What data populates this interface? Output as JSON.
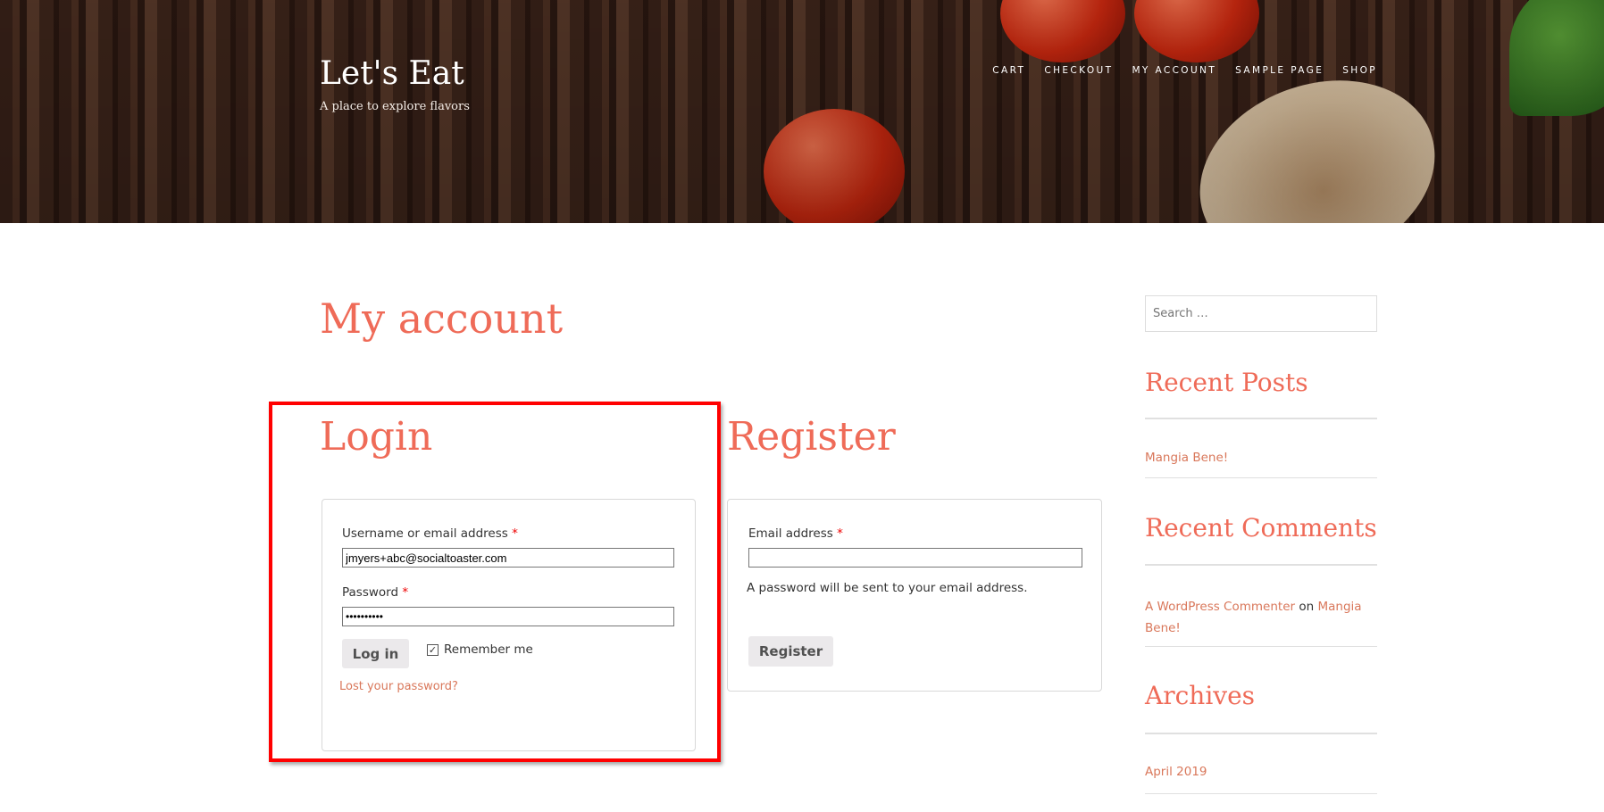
{
  "site": {
    "title": "Let's Eat",
    "tagline": "A place to explore flavors"
  },
  "nav": [
    "CART",
    "CHECKOUT",
    "MY ACCOUNT",
    "SAMPLE PAGE",
    "SHOP"
  ],
  "page_title": "My account",
  "login": {
    "heading": "Login",
    "username_label": "Username or email address",
    "required": "*",
    "username_value": "jmyers+abc@socialtoaster.com",
    "password_label": "Password",
    "password_value": "••••••••••",
    "login_button": "Log in",
    "remember_label": "Remember me",
    "remember_checked": true,
    "lost_password": "Lost your password?"
  },
  "register": {
    "heading": "Register",
    "email_label": "Email address",
    "required": "*",
    "email_value": "",
    "note": "A password will be sent to your email address.",
    "register_button": "Register"
  },
  "sidebar": {
    "search_placeholder": "Search …",
    "recent_posts_title": "Recent Posts",
    "recent_posts": [
      "Mangia Bene!"
    ],
    "recent_comments_title": "Recent Comments",
    "comment_author": "A WordPress Commenter",
    "comment_on": "on",
    "comment_post": "Mangia Bene!",
    "archives_title": "Archives",
    "archives": [
      "April 2019"
    ]
  },
  "colors": {
    "heading": "#ef6b58",
    "link": "#d9775a",
    "highlight": "#ff0000"
  }
}
